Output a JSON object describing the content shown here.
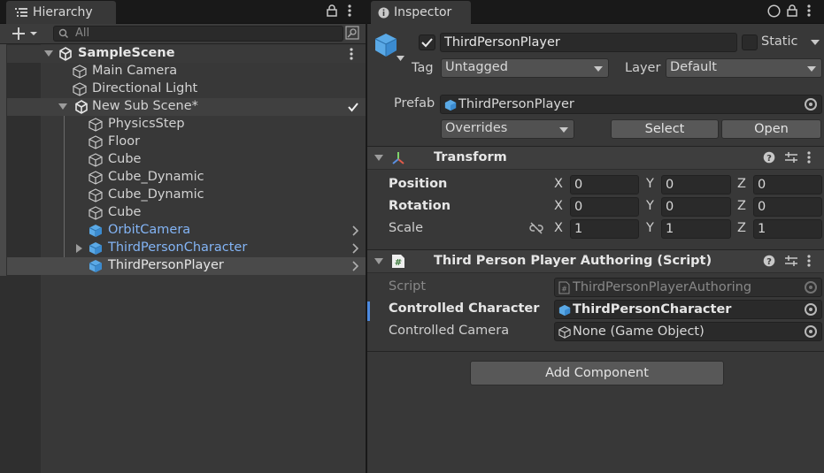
{
  "hierarchy": {
    "tab_label": "Hierarchy",
    "search_placeholder": "All",
    "scene": "SampleScene",
    "items": [
      {
        "label": "Main Camera",
        "type": "gameobject"
      },
      {
        "label": "Directional Light",
        "type": "gameobject"
      },
      {
        "label": "New Sub Scene*",
        "type": "subscene",
        "checked": true
      },
      {
        "label": "PhysicsStep",
        "type": "gameobject"
      },
      {
        "label": "Floor",
        "type": "gameobject"
      },
      {
        "label": "Cube",
        "type": "gameobject"
      },
      {
        "label": "Cube_Dynamic",
        "type": "gameobject"
      },
      {
        "label": "Cube_Dynamic",
        "type": "gameobject"
      },
      {
        "label": "Cube",
        "type": "gameobject"
      },
      {
        "label": "OrbitCamera",
        "type": "prefab"
      },
      {
        "label": "ThirdPersonCharacter",
        "type": "prefab"
      },
      {
        "label": "ThirdPersonPlayer",
        "type": "prefab",
        "selected": true
      }
    ]
  },
  "inspector": {
    "tab_label": "Inspector",
    "object_name": "ThirdPersonPlayer",
    "active": true,
    "static_label": "Static",
    "tag_label": "Tag",
    "tag_value": "Untagged",
    "layer_label": "Layer",
    "layer_value": "Default",
    "prefab_label": "Prefab",
    "prefab_value": "ThirdPersonPlayer",
    "overrides_label": "Overrides",
    "select_label": "Select",
    "open_label": "Open",
    "transform": {
      "title": "Transform",
      "position_label": "Position",
      "rotation_label": "Rotation",
      "scale_label": "Scale",
      "position": {
        "x": "0",
        "y": "0",
        "z": "0"
      },
      "rotation": {
        "x": "0",
        "y": "0",
        "z": "0"
      },
      "scale": {
        "x": "1",
        "y": "1",
        "z": "1"
      },
      "axis_x": "X",
      "axis_y": "Y",
      "axis_z": "Z"
    },
    "script_component": {
      "title": "Third Person Player Authoring (Script)",
      "script_label": "Script",
      "script_value": "ThirdPersonPlayerAuthoring",
      "controlled_character_label": "Controlled Character",
      "controlled_character_value": "ThirdPersonCharacter",
      "controlled_camera_label": "Controlled Camera",
      "controlled_camera_value": "None (Game Object)"
    },
    "add_component_label": "Add Component"
  },
  "colors": {
    "prefab_blue": "#83b4f5",
    "panel_bg": "#383838",
    "field_bg": "#2a2a2a"
  }
}
